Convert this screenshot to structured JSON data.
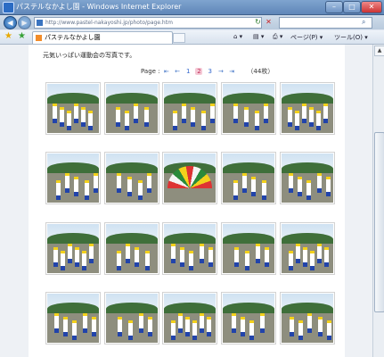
{
  "window": {
    "title": "パステルなかよし園 - Windows Internet Explorer"
  },
  "address": {
    "url": "http://www.pastel-nakayoshi.jp/photo/page.htm"
  },
  "tab": {
    "label": "パステルなかよし園"
  },
  "commands": {
    "home": "⌂ ▾",
    "feed": "▤ ▾",
    "print": "⎙ ▾",
    "page": "ページ(P) ▾",
    "tools": "ツール(O) ▾"
  },
  "content": {
    "caption": "元気いっぱい運動会の写真です。",
    "pager": {
      "label": "Page :",
      "first": "⇤",
      "prev": "←",
      "pages": [
        "1",
        "2",
        "3"
      ],
      "current": "2",
      "next": "→",
      "last": "⇥",
      "count": "（44枚）"
    }
  },
  "photos": [
    "photo-1",
    "photo-2",
    "photo-3",
    "photo-4",
    "photo-5",
    "photo-6",
    "photo-7",
    "photo-8",
    "photo-9",
    "photo-10",
    "photo-11",
    "photo-12",
    "photo-13",
    "photo-14",
    "photo-15",
    "photo-16",
    "photo-17",
    "photo-18",
    "photo-19",
    "photo-20"
  ],
  "colors": {
    "pager_current_bg": "#f5c9d6",
    "link": "#3366cc",
    "titlebar": "#6e93c3"
  }
}
